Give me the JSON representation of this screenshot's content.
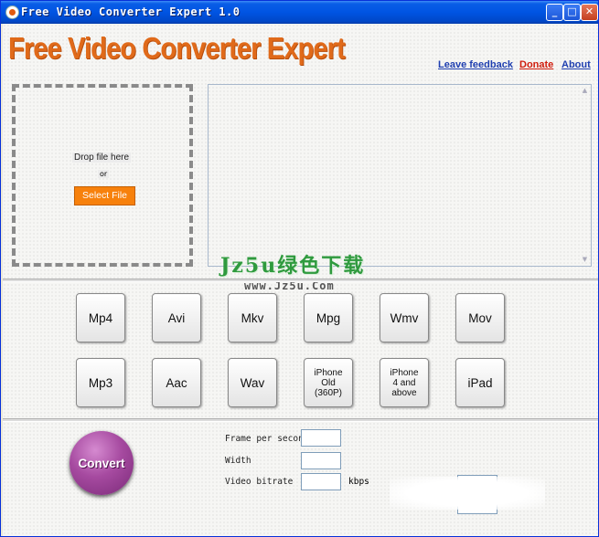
{
  "window": {
    "title": "Free Video Converter Expert 1.0"
  },
  "titlebar": {
    "minimize": "_",
    "maximize": "□",
    "close": "✕"
  },
  "header": {
    "logo_text": "Free Video Converter Expert",
    "links": {
      "feedback": "Leave feedback",
      "donate": "Donate",
      "about": "About"
    }
  },
  "drop_zone": {
    "drop_text": "Drop file here",
    "or_text": "or",
    "select_label": "Select File"
  },
  "file_list": {
    "scroll_up": "▲",
    "scroll_down": "▼"
  },
  "watermark": {
    "text": "Jz5u绿色下载",
    "url": "www.Jz5u.Com"
  },
  "formats": {
    "row1": [
      "Mp4",
      "Avi",
      "Mkv",
      "Mpg",
      "Wmv",
      "Mov"
    ],
    "row2": [
      "Mp3",
      "Aac",
      "Wav",
      "iPhone\nOld\n(360P)",
      "iPhone\n4 and\nabove",
      "iPad"
    ]
  },
  "settings": {
    "convert_label": "Convert",
    "fps_label": "Frame per second",
    "width_label": "Width",
    "bitrate_label": "Video bitrate",
    "kbps_label": "kbps"
  },
  "colors": {
    "accent_orange": "#e06a1a",
    "button_orange": "#f7810c",
    "convert_purple": "#a64aa0",
    "watermark_green": "#2f9a3e"
  }
}
